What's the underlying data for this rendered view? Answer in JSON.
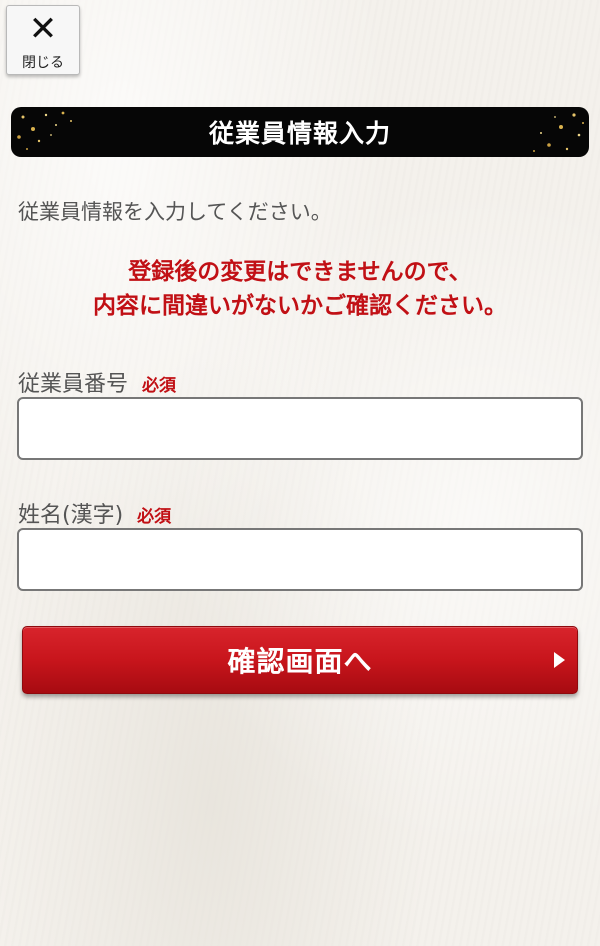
{
  "close_button": {
    "icon": "close-icon",
    "label": "閉じる"
  },
  "header": {
    "title": "従業員情報入力"
  },
  "intro": "従業員情報を入力してください。",
  "warning": {
    "line1": "登録後の変更はできませんので、",
    "line2": "内容に間違いがないかご確認ください。"
  },
  "fields": [
    {
      "label": "従業員番号",
      "required": "必須",
      "value": "",
      "placeholder": ""
    },
    {
      "label": "姓名(漢字)",
      "required": "必須",
      "value": "",
      "placeholder": ""
    }
  ],
  "submit": {
    "label": "確認画面へ",
    "icon": "triangle-right-icon"
  },
  "colors": {
    "accent": "#c11015",
    "header_bg": "#060606",
    "button": "#c8151c"
  }
}
